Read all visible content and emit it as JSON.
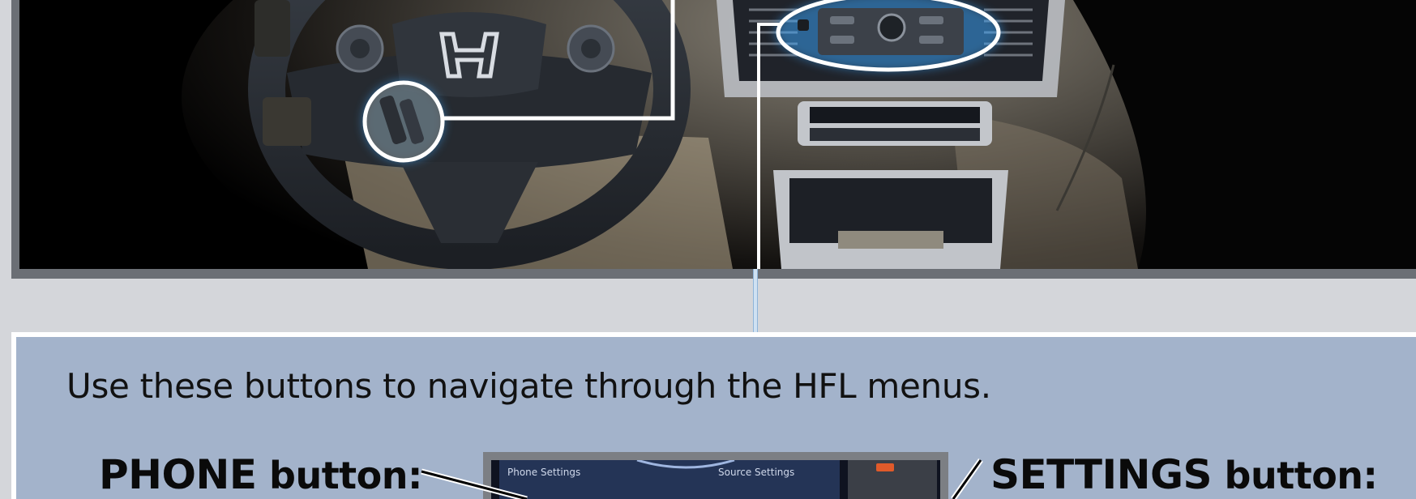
{
  "panel": {
    "intro_text": "Use these buttons to navigate through the HFL menus."
  },
  "labels": {
    "phone_key": "PHONE",
    "phone_suffix": " button:",
    "settings_key": "SETTINGS",
    "settings_suffix": " button:"
  },
  "screen": {
    "left_item": "Phone Settings",
    "right_item": "Source Settings"
  },
  "colors": {
    "panel_bg": "#a3b3cb",
    "frame_gray": "#6b6f75",
    "highlight_glow": "#3aa7ff",
    "callout_white": "#ffffff"
  }
}
